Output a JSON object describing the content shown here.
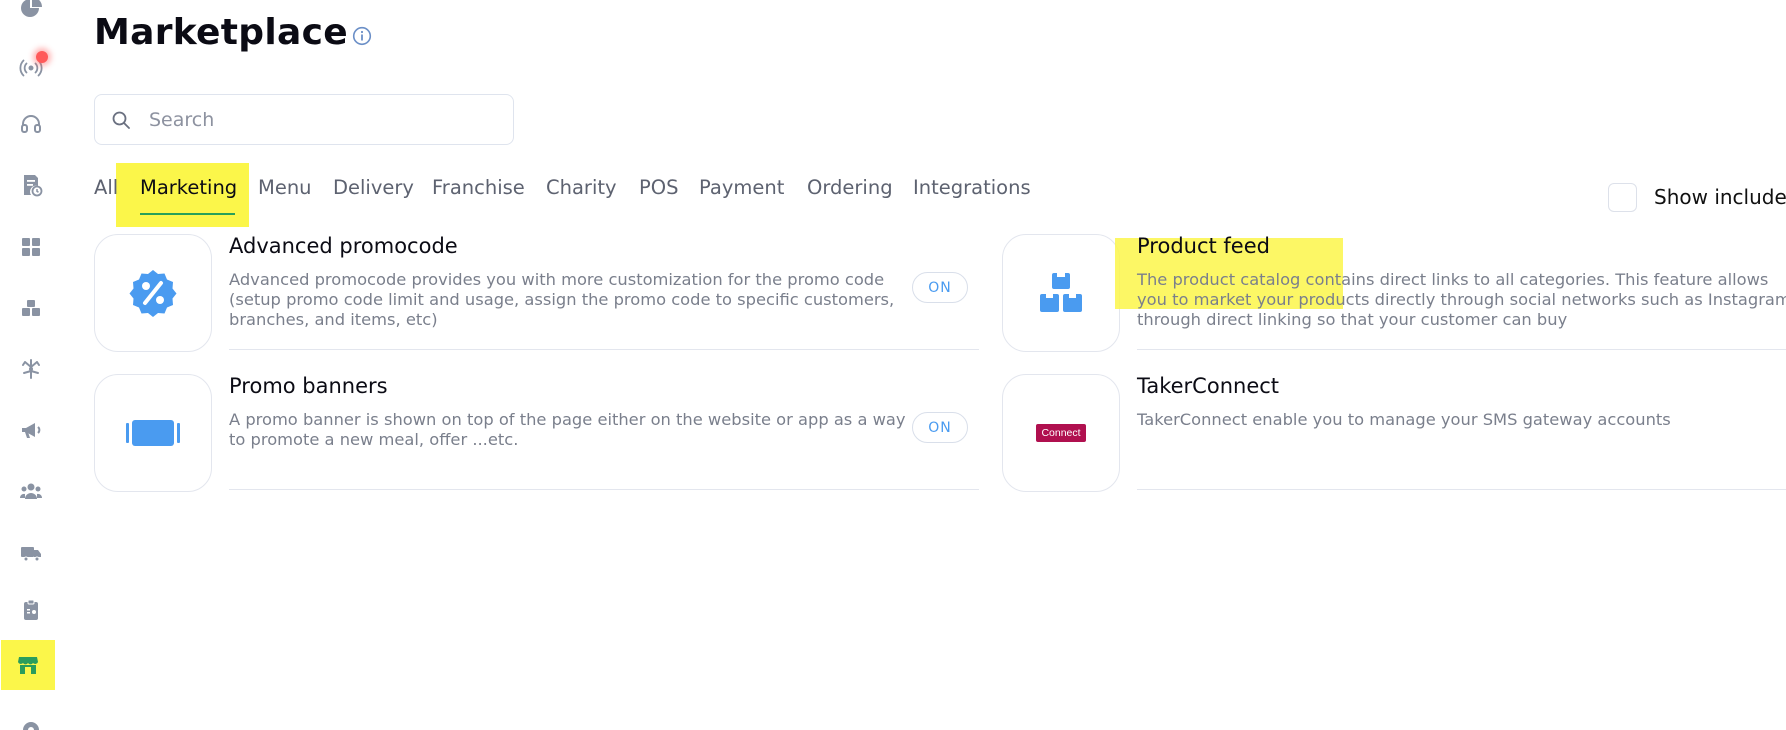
{
  "header": {
    "title": "Marketplace"
  },
  "search": {
    "placeholder": "Search"
  },
  "tabs": [
    {
      "label": "All"
    },
    {
      "label": "Marketing"
    },
    {
      "label": "Menu"
    },
    {
      "label": "Delivery"
    },
    {
      "label": "Franchise"
    },
    {
      "label": "Charity"
    },
    {
      "label": "POS"
    },
    {
      "label": "Payment"
    },
    {
      "label": "Ordering"
    },
    {
      "label": "Integrations"
    }
  ],
  "filters": {
    "show_included_label": "Show included"
  },
  "cards": [
    {
      "title": "Advanced promocode",
      "description": "Advanced promocode provides you with more customization for the promo code (setup promo code limit and usage, assign the promo code to specific customers, branches, and items, etc)",
      "toggle": "ON",
      "icon": "badge-percent-icon"
    },
    {
      "title": "Product feed",
      "description": "The product catalog contains direct links to all categories. This feature allows you to market your products directly through social networks such as Instagram through direct linking so that your customer can buy",
      "icon": "boxes-icon"
    },
    {
      "title": "Promo banners",
      "description": "A promo banner is shown on top of the page either on the website or app as a way to promote a new meal, offer ...etc.",
      "toggle": "ON",
      "icon": "banner-icon"
    },
    {
      "title": "TakerConnect",
      "description": "TakerConnect enable you to manage your SMS gateway accounts",
      "icon": "connect-logo",
      "badge": "Connect"
    }
  ],
  "colors": {
    "accent_blue": "#4a9bf0",
    "highlight": "#fbf64a",
    "tab_underline": "#27a05a",
    "icon_gray": "#8a93a3",
    "active_icon": "#2a9d5c"
  }
}
